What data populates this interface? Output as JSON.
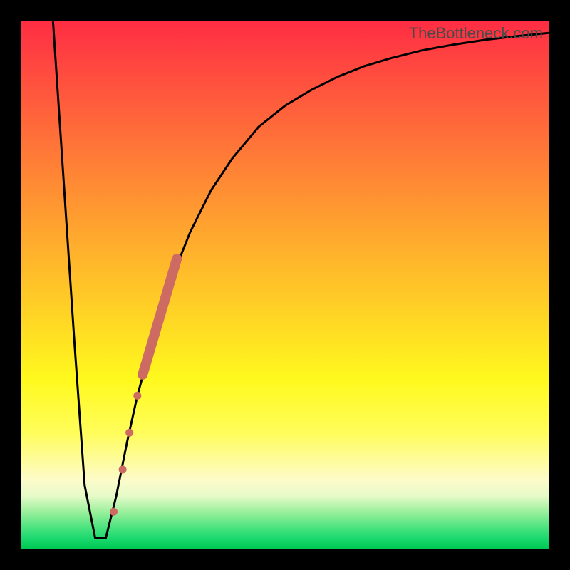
{
  "watermark": "TheBottleneck.com",
  "chart_data": {
    "type": "line",
    "title": "",
    "xlabel": "",
    "ylabel": "",
    "xlim": [
      0,
      100
    ],
    "ylim": [
      0,
      100
    ],
    "series": [
      {
        "name": "bottleneck-curve",
        "x": [
          6,
          8,
          10,
          12,
          14,
          16,
          18,
          20,
          22,
          25,
          28,
          32,
          36,
          40,
          45,
          50,
          55,
          60,
          65,
          70,
          76,
          82,
          88,
          94,
          100
        ],
        "y": [
          100,
          70,
          40,
          12,
          2,
          2,
          10,
          20,
          29,
          40,
          50,
          60,
          68,
          74,
          80,
          84,
          87,
          89.5,
          91.5,
          93,
          94.5,
          95.6,
          96.5,
          97.2,
          97.8
        ]
      }
    ],
    "markers": [
      {
        "name": "dot",
        "x": 17.5,
        "y": 7,
        "r": 5.5
      },
      {
        "name": "dot",
        "x": 19.2,
        "y": 15,
        "r": 5.5
      },
      {
        "name": "dot",
        "x": 20.5,
        "y": 22,
        "r": 5.5
      },
      {
        "name": "dot",
        "x": 22.0,
        "y": 29,
        "r": 5.5
      },
      {
        "name": "thick-segment",
        "x1": 23.0,
        "y1": 33,
        "x2": 29.5,
        "y2": 55,
        "w": 14
      }
    ],
    "colors": {
      "curve": "#000000",
      "markers": "#cd6b63",
      "gradient_top": "#ff2d43",
      "gradient_bottom": "#00c853",
      "frame": "#000000"
    }
  }
}
